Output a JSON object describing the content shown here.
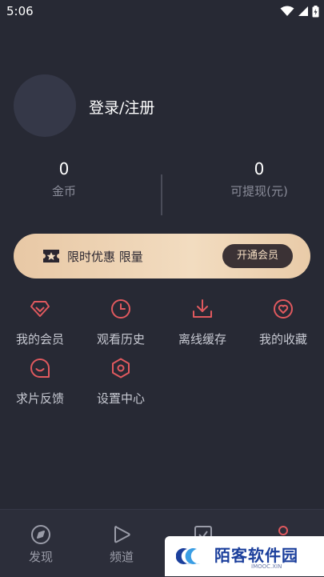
{
  "status_bar": {
    "time": "5:06"
  },
  "profile": {
    "login_text": "登录/注册"
  },
  "stats": [
    {
      "value": "0",
      "label": "金币"
    },
    {
      "value": "0",
      "label": "可提现(元)"
    }
  ],
  "vip_banner": {
    "text": "限时优惠 限量",
    "button_label": "开通会员"
  },
  "menu": [
    {
      "label": "我的会员",
      "icon": "gem-icon"
    },
    {
      "label": "观看历史",
      "icon": "clock-icon"
    },
    {
      "label": "离线缓存",
      "icon": "download-icon"
    },
    {
      "label": "我的收藏",
      "icon": "heart-icon"
    },
    {
      "label": "求片反馈",
      "icon": "feedback-icon"
    },
    {
      "label": "设置中心",
      "icon": "settings-icon"
    }
  ],
  "bottom_nav": [
    {
      "label": "发现",
      "icon": "compass-icon"
    },
    {
      "label": "频道",
      "icon": "play-icon"
    },
    {
      "label": "",
      "icon": "checkbox-icon"
    },
    {
      "label": "",
      "icon": "user-icon"
    }
  ],
  "watermark": {
    "title": "陌客软件园",
    "subtitle": "IMOOC.XIN"
  },
  "colors": {
    "background": "#272934",
    "accent": "#e0595e",
    "banner_gold": "#f2dcc0"
  }
}
